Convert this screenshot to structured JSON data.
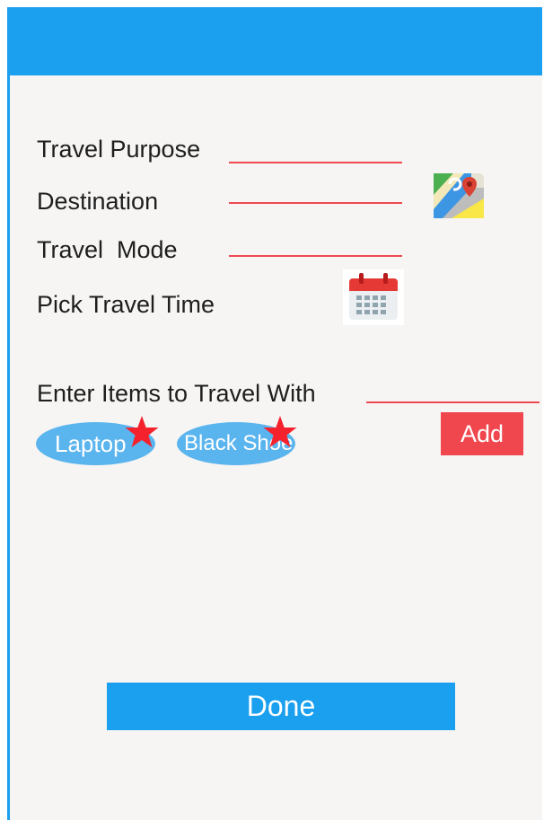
{
  "form": {
    "purpose": {
      "label": "Travel Purpose",
      "value": ""
    },
    "destination": {
      "label": "Destination",
      "value": "",
      "icon": "map-icon"
    },
    "mode": {
      "label": "Travel  Mode",
      "value": ""
    },
    "time": {
      "label": "Pick Travel Time",
      "icon": "calendar-icon"
    },
    "items": {
      "label": "Enter Items to Travel With",
      "value": ""
    }
  },
  "chips": [
    {
      "label": "Laptop",
      "badge_icon": "star-icon"
    },
    {
      "label": "Black Shoe",
      "badge_icon": "star-icon"
    }
  ],
  "actions": {
    "add_label": "Add",
    "done_label": "Done"
  },
  "colors": {
    "primary": "#1aa0ee",
    "accent_red": "#f0464e",
    "underline": "#ee4a52",
    "chip": "#5ab4ee",
    "star": "#f5222d",
    "background": "#f6f5f3"
  }
}
